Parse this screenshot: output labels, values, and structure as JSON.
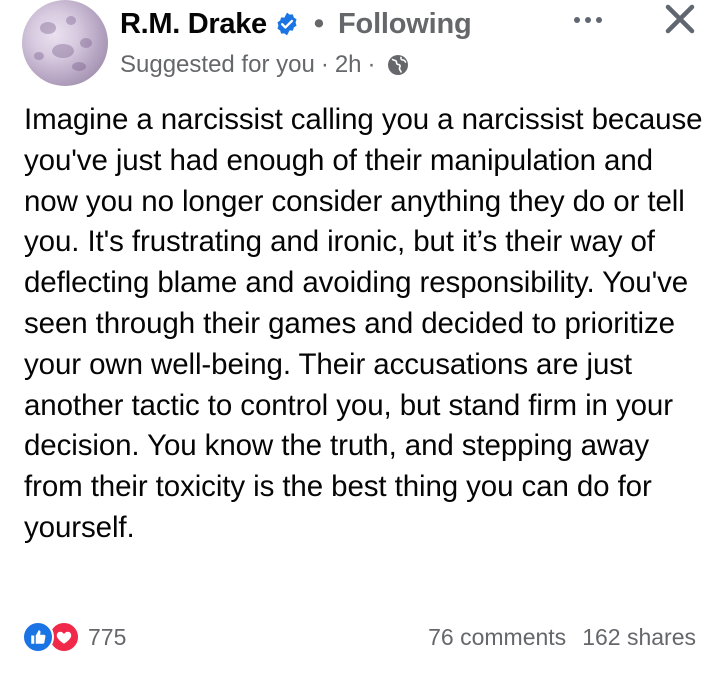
{
  "author": {
    "name": "R.M. Drake",
    "verified": true,
    "follow_status": "Following"
  },
  "meta": {
    "context": "Suggested for you",
    "separator": "·",
    "time": "2h",
    "audience_icon": "globe-icon"
  },
  "header_separator": "•",
  "post": {
    "text": "Imagine a narcissist calling you a narcissist because you've just had enough of their manipulation and now you no longer consider anything they do or tell you. It's frustrating and ironic, but it’s their way of deflecting blame and avoiding responsibility. You've seen through their games and decided to prioritize your own well-being. Their accusations are just another tactic to control you, but stand firm in your decision. You know the truth, and stepping away from their toxicity is the best thing you can do for yourself."
  },
  "footer": {
    "reaction_icons": [
      "like-icon",
      "love-icon"
    ],
    "reaction_count": "775",
    "comments": "76 comments",
    "shares": "162 shares"
  },
  "colors": {
    "text_primary": "#050505",
    "text_secondary": "#65676b",
    "verified_blue": "#1b74e4",
    "like_blue": "#1b74e4",
    "love_red": "#f02849"
  }
}
